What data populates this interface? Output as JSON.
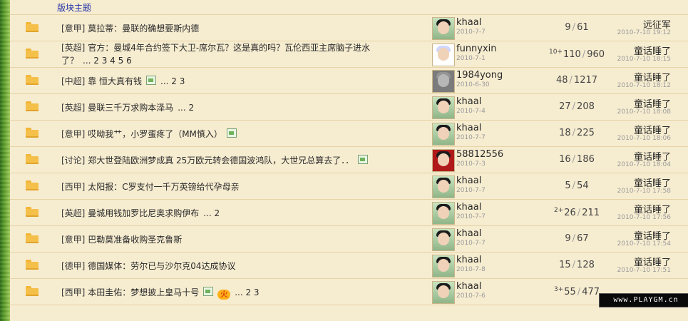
{
  "forum": {
    "section_title": "版块主题"
  },
  "rows": [
    {
      "category": "[意甲]",
      "title": "莫拉蒂：曼联的确想要斯内德",
      "pages": "",
      "has_image_icon": false,
      "has_hot_icon": false,
      "author": "khaal",
      "author_date": "2010-7-7",
      "avatar_style": "photo",
      "replies_prefix": "",
      "replies": "9",
      "views": "61",
      "last_user": "远征军",
      "last_time": "2010-7-10 19:12"
    },
    {
      "category": "[英超]",
      "title": "官方：曼城4年合约签下大卫-席尔瓦？这是真的吗？瓦伦西亚主席脑子进水了？",
      "pages": "... 2 3 4 5 6",
      "has_image_icon": false,
      "has_hot_icon": false,
      "author": "funnyxin",
      "author_date": "2010-7-1",
      "avatar_style": "cartoon",
      "replies_prefix": "10+",
      "replies": "110",
      "views": "960",
      "last_user": "童话睡了",
      "last_time": "2010-7-10 18:15"
    },
    {
      "category": "[中超]",
      "title": "靠  恒大真有钱",
      "pages": "... 2 3",
      "has_image_icon": true,
      "has_hot_icon": false,
      "author": "1984yong",
      "author_date": "2010-6-30",
      "avatar_style": "gray",
      "replies_prefix": "",
      "replies": "48",
      "views": "1217",
      "last_user": "童话睡了",
      "last_time": "2010-7-10 18:12"
    },
    {
      "category": "[英超]",
      "title": "曼联三千万求购本泽马",
      "pages": "... 2",
      "has_image_icon": false,
      "has_hot_icon": false,
      "author": "khaal",
      "author_date": "2010-7-4",
      "avatar_style": "photo",
      "replies_prefix": "",
      "replies": "27",
      "views": "208",
      "last_user": "童话睡了",
      "last_time": "2010-7-10 18:08"
    },
    {
      "category": "[意甲]",
      "title": "哎呦我艹，小罗蛋疼了（MM慎入）",
      "pages": "",
      "has_image_icon": true,
      "has_hot_icon": false,
      "author": "khaal",
      "author_date": "2010-7-7",
      "avatar_style": "photo",
      "replies_prefix": "",
      "replies": "18",
      "views": "225",
      "last_user": "童话睡了",
      "last_time": "2010-7-10 18:06"
    },
    {
      "category": "[讨论]",
      "title": "郑大世登陆欧洲梦成真  25万欧元转会德国波鸿队，大世兄总算去了．．",
      "pages": "",
      "has_image_icon": true,
      "has_hot_icon": false,
      "author": "58812556",
      "author_date": "2010-7-3",
      "avatar_style": "red",
      "replies_prefix": "",
      "replies": "16",
      "views": "186",
      "last_user": "童话睡了",
      "last_time": "2010-7-10 18:04"
    },
    {
      "category": "[西甲]",
      "title": "太阳报：C罗支付一千万英镑给代孕母亲",
      "pages": "",
      "has_image_icon": false,
      "has_hot_icon": false,
      "author": "khaal",
      "author_date": "2010-7-7",
      "avatar_style": "photo",
      "replies_prefix": "",
      "replies": "5",
      "views": "54",
      "last_user": "童话睡了",
      "last_time": "2010-7-10 17:58"
    },
    {
      "category": "[英超]",
      "title": "曼城用钱加罗比尼奥求购伊布",
      "pages": "... 2",
      "has_image_icon": false,
      "has_hot_icon": false,
      "author": "khaal",
      "author_date": "2010-7-7",
      "avatar_style": "photo",
      "replies_prefix": "2+",
      "replies": "26",
      "views": "211",
      "last_user": "童话睡了",
      "last_time": "2010-7-10 17:56"
    },
    {
      "category": "[意甲]",
      "title": "巴勒莫准备收购圣克鲁斯",
      "pages": "",
      "has_image_icon": false,
      "has_hot_icon": false,
      "author": "khaal",
      "author_date": "2010-7-7",
      "avatar_style": "photo",
      "replies_prefix": "",
      "replies": "9",
      "views": "67",
      "last_user": "童话睡了",
      "last_time": "2010-7-10 17:54"
    },
    {
      "category": "[德甲]",
      "title": "德国媒体：劳尔已与沙尔克04达成协议",
      "pages": "",
      "has_image_icon": false,
      "has_hot_icon": false,
      "author": "khaal",
      "author_date": "2010-7-8",
      "avatar_style": "photo",
      "replies_prefix": "",
      "replies": "15",
      "views": "128",
      "last_user": "童话睡了",
      "last_time": "2010-7-10 17:51"
    },
    {
      "category": "[西甲]",
      "title": "本田圭佑：梦想披上皇马十号",
      "pages": "... 2 3",
      "has_image_icon": true,
      "has_hot_icon": true,
      "hot_label": "火",
      "author": "khaal",
      "author_date": "2010-7-6",
      "avatar_style": "photo",
      "replies_prefix": "3+",
      "replies": "55",
      "views": "477",
      "last_user": "",
      "last_time": "2010-7-10 17:47"
    }
  ],
  "watermark": {
    "text": "www.PLAYGM.cn"
  }
}
